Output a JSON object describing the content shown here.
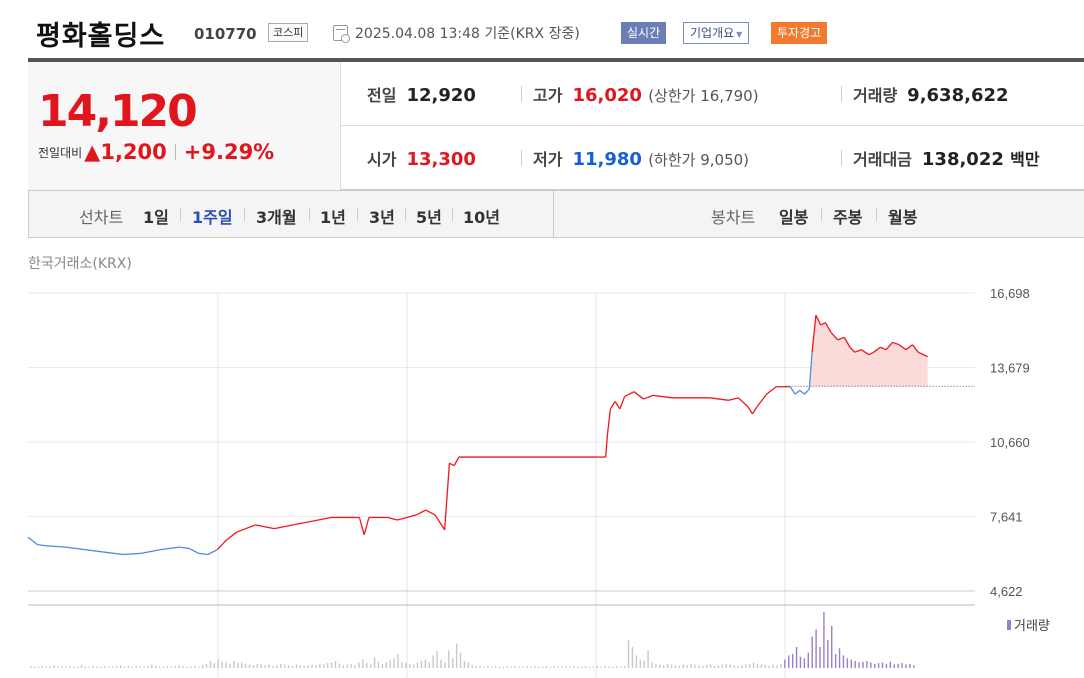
{
  "header": {
    "name": "평화홀딩스",
    "code": "010770",
    "market": "코스피",
    "timestamp": "2025.04.08 13:48  기준(KRX 장중)",
    "badge_live": "실시간",
    "badge_info": "기업개요",
    "badge_warn": "투자경고"
  },
  "quote": {
    "price": "14,120",
    "change_label": "전일대비",
    "change_arrow": "▲",
    "change": "1,200",
    "change_pct": "+9.29%",
    "prev_label": "전일",
    "prev": "12,920",
    "high_label": "고가",
    "high": "16,020",
    "upper_limit": "(상한가 16,790)",
    "volume_label": "거래량",
    "volume": "9,638,622",
    "open_label": "시가",
    "open": "13,300",
    "low_label": "저가",
    "low": "11,980",
    "lower_limit": "(하한가 9,050)",
    "amount_label": "거래대금",
    "amount": "138,022",
    "amount_unit": "백만"
  },
  "tabs": {
    "line_label": "선차트",
    "periods": [
      "1일",
      "1주일",
      "3개월",
      "1년",
      "3년",
      "5년",
      "10년"
    ],
    "selected": "1주일",
    "candle_label": "봉차트",
    "candles": [
      "일봉",
      "주봉",
      "월봉"
    ]
  },
  "chart": {
    "source": "한국거래소(KRX)",
    "y_ticks": [
      "16,698",
      "13,679",
      "10,660",
      "7,641",
      "4,622"
    ],
    "volume_legend": "거래량",
    "colors": {
      "up": "#f0171c",
      "down": "#4a8ae8",
      "fill": "#fbdada",
      "volume": "#c8c8c8",
      "volume_recent": "#9b7fcb"
    }
  },
  "chart_data": {
    "type": "line",
    "ylim": [
      4622,
      16698
    ],
    "baseline": 12920,
    "price_path": [
      [
        0,
        6800
      ],
      [
        0.01,
        6500
      ],
      [
        0.02,
        6450
      ],
      [
        0.04,
        6400
      ],
      [
        0.06,
        6300
      ],
      [
        0.08,
        6200
      ],
      [
        0.1,
        6100
      ],
      [
        0.12,
        6150
      ],
      [
        0.14,
        6300
      ],
      [
        0.16,
        6400
      ],
      [
        0.17,
        6350
      ],
      [
        0.18,
        6150
      ],
      [
        0.19,
        6100
      ],
      [
        0.2,
        6300
      ],
      [
        0.21,
        6700
      ],
      [
        0.22,
        7000
      ],
      [
        0.24,
        7300
      ],
      [
        0.26,
        7150
      ],
      [
        0.28,
        7300
      ],
      [
        0.3,
        7450
      ],
      [
        0.32,
        7600
      ],
      [
        0.34,
        7600
      ],
      [
        0.35,
        7600
      ],
      [
        0.355,
        6900
      ],
      [
        0.36,
        7600
      ],
      [
        0.38,
        7600
      ],
      [
        0.39,
        7500
      ],
      [
        0.4,
        7600
      ],
      [
        0.41,
        7700
      ],
      [
        0.42,
        7900
      ],
      [
        0.43,
        7700
      ],
      [
        0.44,
        7100
      ],
      [
        0.445,
        9800
      ],
      [
        0.45,
        9700
      ],
      [
        0.455,
        10050
      ],
      [
        0.5,
        10050
      ],
      [
        0.6,
        10050
      ],
      [
        0.61,
        10050
      ],
      [
        0.612,
        11000
      ],
      [
        0.615,
        12000
      ],
      [
        0.62,
        12300
      ],
      [
        0.625,
        12000
      ],
      [
        0.63,
        12500
      ],
      [
        0.64,
        12700
      ],
      [
        0.65,
        12400
      ],
      [
        0.66,
        12550
      ],
      [
        0.68,
        12450
      ],
      [
        0.7,
        12450
      ],
      [
        0.72,
        12450
      ],
      [
        0.74,
        12350
      ],
      [
        0.75,
        12450
      ],
      [
        0.76,
        12100
      ],
      [
        0.765,
        11800
      ],
      [
        0.77,
        12100
      ],
      [
        0.78,
        12600
      ],
      [
        0.79,
        12900
      ],
      [
        0.8,
        12900
      ],
      [
        0.805,
        12900
      ],
      [
        0.81,
        12600
      ],
      [
        0.815,
        12750
      ],
      [
        0.82,
        12600
      ],
      [
        0.825,
        12800
      ],
      [
        0.828,
        14300
      ],
      [
        0.832,
        15800
      ],
      [
        0.837,
        15400
      ],
      [
        0.842,
        15500
      ],
      [
        0.848,
        15100
      ],
      [
        0.855,
        14800
      ],
      [
        0.862,
        14900
      ],
      [
        0.868,
        14500
      ],
      [
        0.873,
        14300
      ],
      [
        0.88,
        14400
      ],
      [
        0.888,
        14200
      ],
      [
        0.893,
        14300
      ],
      [
        0.9,
        14500
      ],
      [
        0.906,
        14400
      ],
      [
        0.913,
        14700
      ],
      [
        0.92,
        14600
      ],
      [
        0.927,
        14400
      ],
      [
        0.934,
        14600
      ],
      [
        0.94,
        14300
      ],
      [
        0.95,
        14120
      ]
    ],
    "volume": [
      3,
      2,
      2,
      3,
      2,
      2,
      4,
      2,
      3,
      2,
      3,
      2,
      2,
      4,
      2,
      2,
      3,
      2,
      2,
      3,
      2,
      2,
      3,
      4,
      2,
      3,
      2,
      3,
      2,
      2,
      3,
      5,
      3,
      2,
      2,
      3,
      2,
      3,
      4,
      3,
      2,
      2,
      3,
      2,
      4,
      6,
      10,
      7,
      12,
      9,
      8,
      6,
      10,
      7,
      8,
      6,
      5,
      4,
      6,
      5,
      4,
      5,
      3,
      4,
      6,
      5,
      4,
      3,
      5,
      4,
      3,
      4,
      5,
      4,
      6,
      5,
      7,
      8,
      10,
      6,
      4,
      5,
      6,
      4,
      8,
      12,
      7,
      5,
      15,
      9,
      6,
      8,
      11,
      14,
      20,
      9,
      7,
      6,
      5,
      8,
      10,
      12,
      8,
      18,
      24,
      12,
      8,
      25,
      14,
      35,
      22,
      10,
      8,
      4,
      3,
      3,
      2,
      3,
      2,
      3,
      2,
      2,
      3,
      2,
      3,
      2,
      2,
      3,
      2,
      3,
      2,
      2,
      3,
      2,
      3,
      2,
      2,
      3,
      2,
      3,
      2,
      2,
      3,
      2,
      2,
      3,
      2,
      3,
      2,
      2,
      3,
      2,
      3,
      40,
      30,
      18,
      12,
      10,
      25,
      8,
      6,
      5,
      4,
      6,
      5,
      4,
      3,
      5,
      4,
      6,
      5,
      4,
      3,
      4,
      5,
      3,
      4,
      5,
      6,
      5,
      4,
      3,
      4,
      5,
      6,
      8,
      6,
      5,
      4,
      3,
      5,
      4,
      6,
      12,
      18,
      20,
      30,
      16,
      14,
      22,
      45,
      55,
      30,
      80,
      40,
      60,
      20,
      28,
      18,
      14,
      12,
      10,
      8,
      9,
      10,
      8,
      6,
      7,
      8,
      6,
      9,
      5,
      6,
      7,
      5,
      6,
      4
    ]
  }
}
